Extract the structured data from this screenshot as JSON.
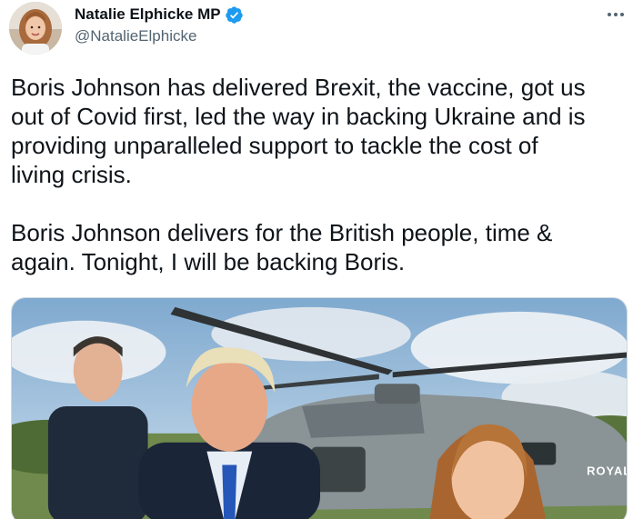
{
  "author": {
    "display_name": "Natalie Elphicke MP",
    "handle": "@NatalieElphicke",
    "verified": true,
    "avatar_icon": "avatar-photo"
  },
  "menu": {
    "icon": "more-dots-icon"
  },
  "tweet": {
    "paragraphs": [
      "Boris Johnson has delivered Brexit, the vaccine, got us\nout of Covid first, led the way in backing Ukraine and is\nproviding unparalleled support to tackle the cost of\nliving crisis.",
      "Boris Johnson delivers for the British people, time &\nagain. Tonight, I will be backing Boris."
    ]
  },
  "media": {
    "helicopter_label": "ROYAL"
  },
  "colors": {
    "verified_blue": "#1d9bf0",
    "text": "#0f1419",
    "secondary_text": "#536471"
  }
}
